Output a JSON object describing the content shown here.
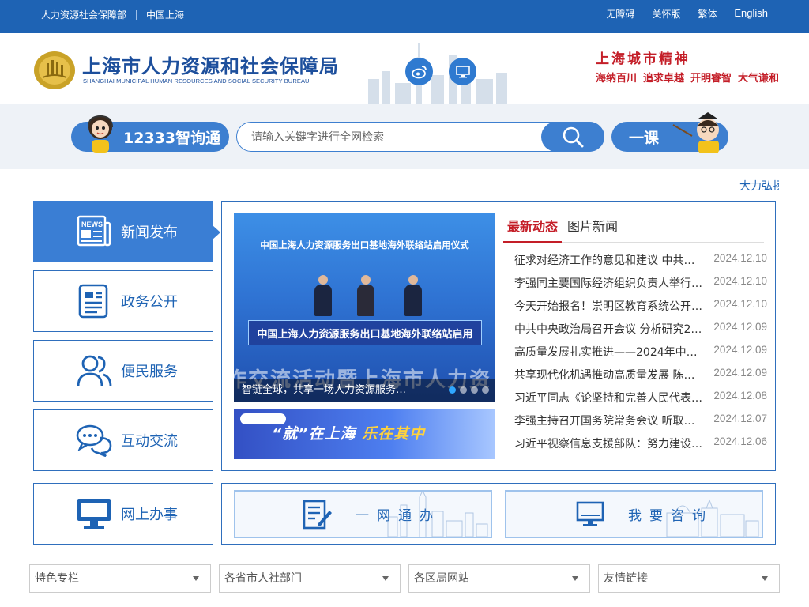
{
  "topbar": {
    "left_links": [
      "人力资源社会保障部",
      "中国上海"
    ],
    "right_links": [
      "无障碍",
      "关怀版",
      "繁体",
      "English"
    ]
  },
  "header": {
    "title": "上海市人力资源和社会保障局",
    "subtitle": "SHANGHAI MUNICIPAL HUMAN RESOURCES AND SOCIAL SECURITY BUREAU",
    "spirit_title": "上海城市精神",
    "spirit_words": [
      "海纳百川",
      "追求卓越",
      "开明睿智",
      "大气谦和"
    ]
  },
  "search": {
    "assistant_label": "12333智询通",
    "placeholder": "请输入关键字进行全网检索",
    "course_label": "一课"
  },
  "marquee": {
    "text": "大力弘扬"
  },
  "left_nav": [
    {
      "label": "新闻发布",
      "icon": "news-icon",
      "active": true
    },
    {
      "label": "政务公开",
      "icon": "document-icon",
      "active": false
    },
    {
      "label": "便民服务",
      "icon": "users-icon",
      "active": false
    },
    {
      "label": "互动交流",
      "icon": "chat-icon",
      "active": false
    },
    {
      "label": "网上办事",
      "icon": "monitor-icon",
      "active": false
    }
  ],
  "carousel": {
    "top_text": "中国上海人力资源服务出口基地海外联络站启用仪式",
    "board_text": "中国上海人力资源服务出口基地海外联络站启用",
    "big_text": "作交流活动暨上海市人力资",
    "caption": "智链全球，共享一场人力资源服务…",
    "dots": 4,
    "active_dot": 0
  },
  "banner2": {
    "pre": "“就”在上海",
    "highlight": "乐在其中"
  },
  "news": {
    "tabs": [
      "最新动态",
      "图片新闻"
    ],
    "items": [
      {
        "title": "征求对经济工作的意见和建议 中共中…",
        "date": "2024.12.10"
      },
      {
        "title": "李强同主要国际经济组织负责人举行…",
        "date": "2024.12.10"
      },
      {
        "title": "今天开始报名！崇明区教育系统公开…",
        "date": "2024.12.10"
      },
      {
        "title": "中共中央政治局召开会议 分析研究2…",
        "date": "2024.12.09"
      },
      {
        "title": "高质量发展扎实推进——2024年中…",
        "date": "2024.12.09"
      },
      {
        "title": "共享现代化机遇推动高质量发展 陈吉…",
        "date": "2024.12.09"
      },
      {
        "title": "习近平同志《论坚持和完善人民代表…",
        "date": "2024.12.08"
      },
      {
        "title": "李强主持召开国务院常务会议 听取推…",
        "date": "2024.12.07"
      },
      {
        "title": "习近平视察信息支援部队：努力建设…",
        "date": "2024.12.06"
      }
    ]
  },
  "services": [
    {
      "label": "一网通办",
      "icon": "form-edit-icon"
    },
    {
      "label": "我要咨询",
      "icon": "monitor-icon"
    }
  ],
  "dropdowns": [
    "特色专栏",
    "各省市人社部门",
    "各区局网站",
    "友情链接"
  ],
  "colors": {
    "primary": "#1e63b4",
    "accent_red": "#c41e28",
    "button_blue": "#3d7fd0"
  }
}
